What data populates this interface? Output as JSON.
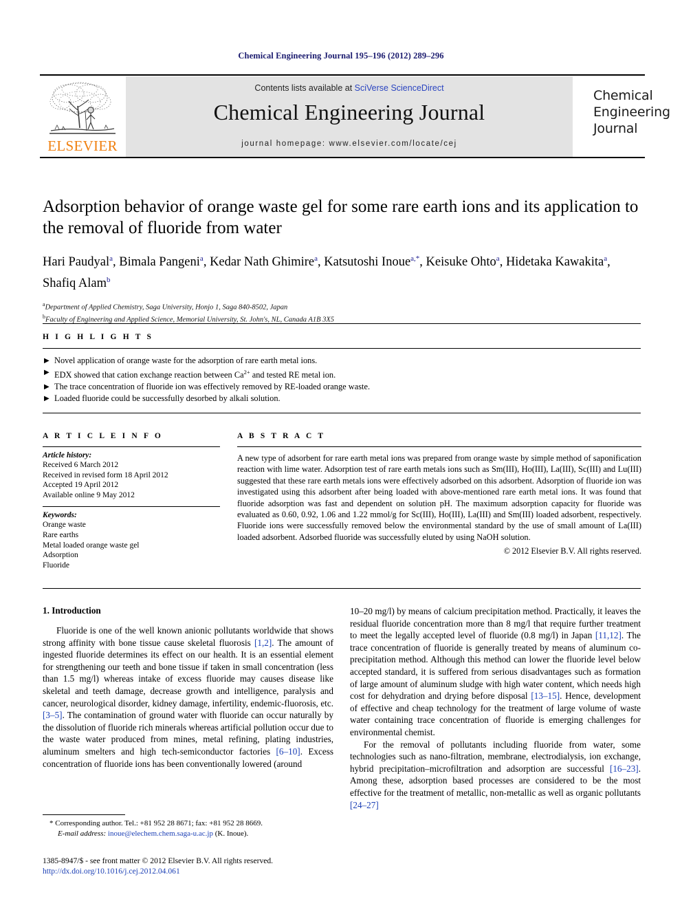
{
  "running_head": "Chemical Engineering Journal 195–196 (2012) 289–296",
  "masthead": {
    "contents_prefix": "Contents lists available at ",
    "contents_link": "SciVerse ScienceDirect",
    "journal_title": "Chemical Engineering Journal",
    "homepage": "journal homepage: www.elsevier.com/locate/cej",
    "publisher_logo_text": "ELSEVIER",
    "cover_line1": "Chemical",
    "cover_line2": "Engineering",
    "cover_line3": "Journal",
    "accent_orange": "#f08010",
    "link_blue": "#2b45c0"
  },
  "article": {
    "title": "Adsorption behavior of orange waste gel for some rare earth ions and its application to the removal of fluoride from water",
    "authors_line1_parts": [
      {
        "name": "Hari Paudyal",
        "sup": "a"
      },
      {
        "name": "Bimala Pangeni",
        "sup": "a"
      },
      {
        "name": "Kedar Nath Ghimire",
        "sup": "a"
      },
      {
        "name": "Katsutoshi Inoue",
        "sup": "a,*"
      },
      {
        "name": "Keisuke Ohto",
        "sup": "a"
      }
    ],
    "authors_line2_parts": [
      {
        "name": "Hidetaka Kawakita",
        "sup": "a"
      },
      {
        "name": "Shafiq Alam",
        "sup": "b"
      }
    ],
    "affiliations": [
      {
        "label": "a",
        "text": "Department of Applied Chemistry, Saga University, Honjo 1, Saga 840-8502, Japan"
      },
      {
        "label": "b",
        "text": "Faculty of Engineering and Applied Science, Memorial University, St. John's, NL, Canada A1B 3X5"
      }
    ]
  },
  "highlights": {
    "heading": "H I G H L I G H T S",
    "items": [
      "Novel application of orange waste for the adsorption of rare earth metal ions.",
      "EDX showed that cation exchange reaction between Ca2+ and tested RE metal ion.",
      "The trace concentration of fluoride ion was effectively removed by RE-loaded orange waste.",
      "Loaded fluoride could be successfully desorbed by alkali solution."
    ],
    "bullet_glyph": "▶"
  },
  "article_info": {
    "heading": "A R T I C L E    I N F O",
    "history_label": "Article history:",
    "history": [
      "Received 6 March 2012",
      "Received in revised form 18 April 2012",
      "Accepted 19 April 2012",
      "Available online 9 May 2012"
    ],
    "keywords_label": "Keywords:",
    "keywords": [
      "Orange waste",
      "Rare earths",
      "Metal loaded orange waste gel",
      "Adsorption",
      "Fluoride"
    ]
  },
  "abstract": {
    "heading": "A B S T R A C T",
    "text": "A new type of adsorbent for rare earth metal ions was prepared from orange waste by simple method of saponification reaction with lime water. Adsorption test of rare earth metals ions such as Sm(III), Ho(III), La(III), Sc(III) and Lu(III) suggested that these rare earth metals ions were effectively adsorbed on this adsorbent. Adsorption of fluoride ion was investigated using this adsorbent after being loaded with above-mentioned rare earth metal ions. It was found that fluoride adsorption was fast and dependent on solution pH. The maximum adsorption capacity for fluoride was evaluated as 0.60, 0.92, 1.06 and 1.22 mmol/g for Sc(III), Ho(III), La(III) and Sm(III) loaded adsorbent, respectively. Fluoride ions were successfully removed below the environmental standard by the use of small amount of La(III) loaded adsorbent. Adsorbed fluoride was successfully eluted by using NaOH solution.",
    "copyright": "© 2012 Elsevier B.V. All rights reserved."
  },
  "body": {
    "section_number_title": "1. Introduction",
    "left_paragraph_1": "Fluoride is one of the well known anionic pollutants worldwide that shows strong affinity with bone tissue cause skeletal fluorosis [1,2]. The amount of ingested fluoride determines its effect on our health. It is an essential element for strengthening our teeth and bone tissue if taken in small concentration (less than 1.5 mg/l) whereas intake of excess fluoride may causes disease like skeletal and teeth damage, decrease growth and intelligence, paralysis and cancer, neurological disorder, kidney damage, infertility, endemic-fluorosis, etc. [3–5]. The contamination of ground water with fluoride can occur naturally by the dissolution of fluoride rich minerals whereas artificial pollution occur due to the waste water produced from mines, metal refining, plating industries, aluminum smelters and high tech-semiconductor factories [6–10]. Excess concentration of fluoride ions has been conventionally lowered (around",
    "right_paragraph_1": "10–20 mg/l) by means of calcium precipitation method. Practically, it leaves the residual fluoride concentration more than 8 mg/l that require further treatment to meet the legally accepted level of fluoride (0.8 mg/l) in Japan [11,12]. The trace concentration of fluoride is generally treated by means of aluminum co-precipitation method. Although this method can lower the fluoride level below accepted standard, it is suffered from serious disadvantages such as formation of large amount of aluminum sludge with high water content, which needs high cost for dehydration and drying before disposal [13–15]. Hence, development of effective and cheap technology for the treatment of large volume of waste water containing trace concentration of fluoride is emerging challenges for environmental chemist.",
    "right_paragraph_2": "For the removal of pollutants including fluoride from water, some technologies such as nano-filtration, membrane, electrodialysis, ion exchange, hybrid precipitation–microfiltration and adsorption are successful [16–23]. Among these, adsorption based processes are considered to be the most effective for the treatment of metallic, non-metallic as well as organic pollutants [24–27]"
  },
  "footnotes": {
    "corresponding_marker": "*",
    "corresponding_text": "Corresponding author. Tel.: +81 952 28 8671; fax: +81 952 28 8669.",
    "email_label": "E-mail address:",
    "email": "inoue@elechem.chem.saga-u.ac.jp",
    "email_suffix": "(K. Inoue).",
    "issn_line": "1385-8947/$ - see front matter © 2012 Elsevier B.V. All rights reserved.",
    "doi_line": "http://dx.doi.org/10.1016/j.cej.2012.04.061"
  }
}
